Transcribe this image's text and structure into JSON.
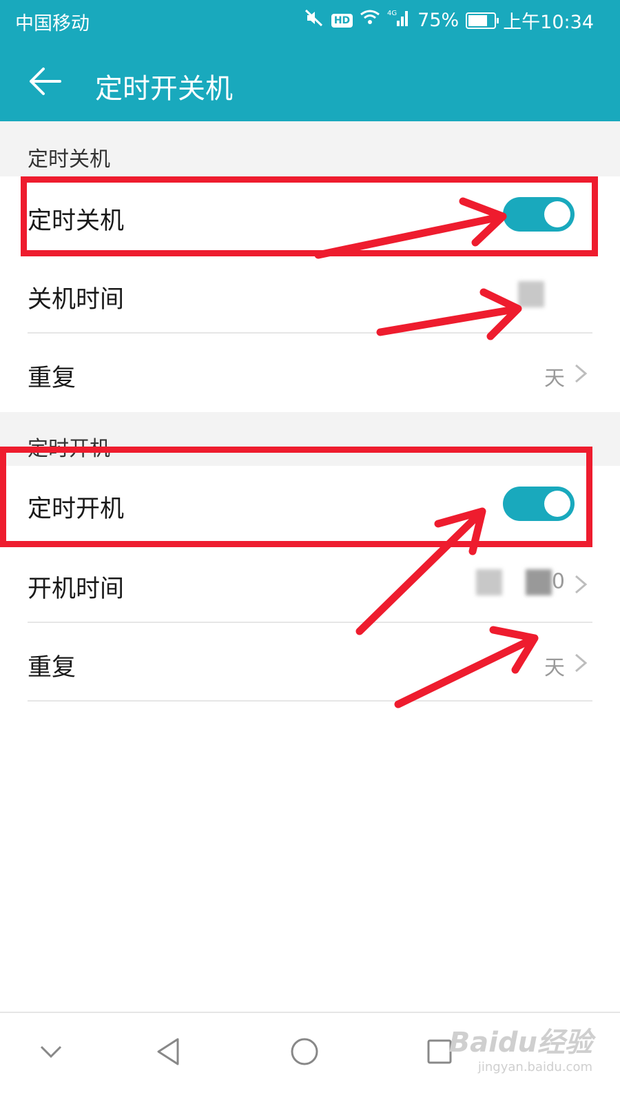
{
  "status_bar": {
    "carrier": "中国移动",
    "network": "4G",
    "battery": "75%",
    "battery_level": 0.75,
    "time": "上午10:34"
  },
  "app_bar": {
    "title": "定时开关机",
    "back_icon": "arrow-left-icon"
  },
  "sections": [
    {
      "header": "定时关机",
      "toggle_label": "定时关机",
      "toggle_on": true,
      "time_label": "关机时间",
      "repeat_label": "重复",
      "repeat_value": "天"
    },
    {
      "header": "定时开机",
      "toggle_label": "定时开机",
      "toggle_on": true,
      "time_label": "开机时间",
      "time_value_tail": "0",
      "repeat_label": "重复",
      "repeat_value": "天"
    }
  ],
  "nav": {
    "icons": [
      "chevron-down-icon",
      "back-triangle-icon",
      "home-circle-icon",
      "recents-square-icon"
    ]
  },
  "watermark": {
    "main": "Baidu经验",
    "sub": "jingyan.baidu.com"
  },
  "colors": {
    "accent": "#19a9bd",
    "annotation": "#ee1c2e"
  }
}
